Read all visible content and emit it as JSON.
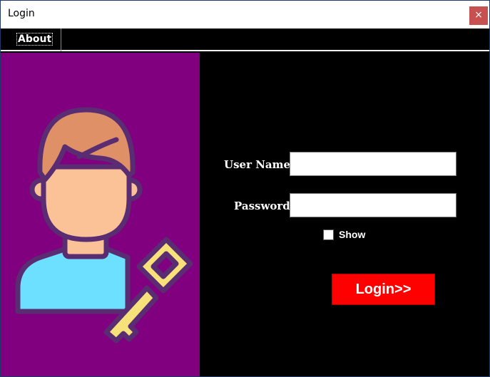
{
  "window": {
    "title": "Login",
    "close_glyph": "×"
  },
  "menu": {
    "items": [
      {
        "label": "About"
      }
    ]
  },
  "illustration": {
    "icon": "user-with-key-icon",
    "colors": {
      "background": "#800080",
      "hair": "#E09066",
      "skin": "#FBC197",
      "shirt": "#6EE0FF",
      "key": "#F6E17A",
      "outline": "#5A2C72"
    }
  },
  "form": {
    "username_label": "User Name",
    "username_value": "",
    "password_label": "Password",
    "password_value": "",
    "show_label": "Show",
    "show_checked": false,
    "login_label": "Login>>"
  },
  "colors": {
    "form_background": "#000000",
    "login_button": "#FF0000",
    "close_button": "#C75050"
  }
}
